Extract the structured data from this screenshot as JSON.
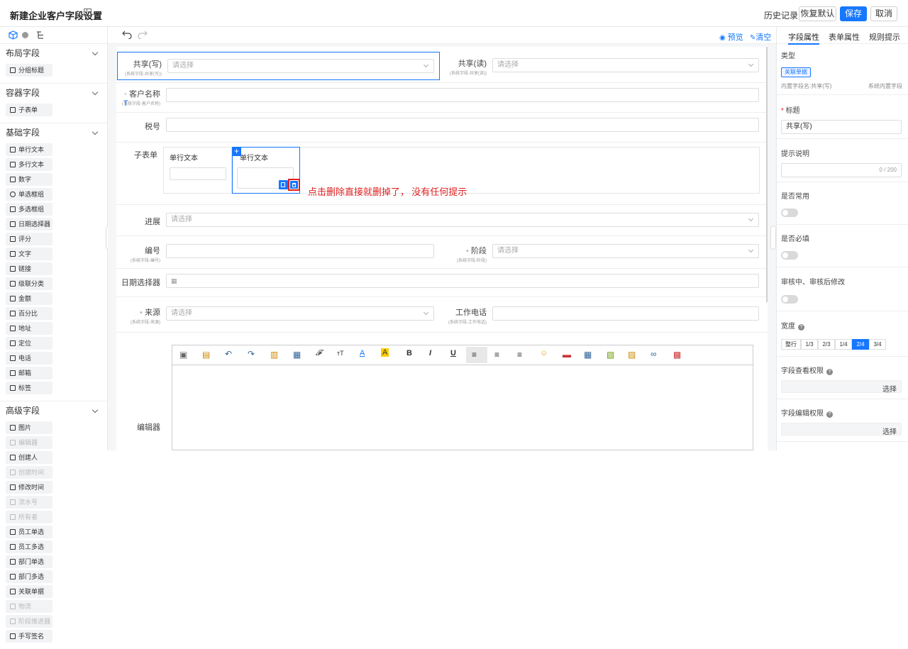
{
  "header": {
    "title": "新建企业客户字段设置",
    "history": "历史记录",
    "restore": "恢复默认",
    "save": "保存",
    "cancel": "取消"
  },
  "left": {
    "sections": [
      {
        "title": "布局字段",
        "items": [
          {
            "label": "分组标题"
          }
        ]
      },
      {
        "title": "容器字段",
        "items": [
          {
            "label": "子表单"
          }
        ]
      },
      {
        "title": "基础字段",
        "items": [
          {
            "label": "单行文本"
          },
          {
            "label": "多行文本"
          },
          {
            "label": "数字"
          },
          {
            "label": "单选框组"
          },
          {
            "label": "多选框组"
          },
          {
            "label": "日期选择器"
          },
          {
            "label": "评分"
          },
          {
            "label": "文字"
          },
          {
            "label": "链接"
          },
          {
            "label": "级联分类"
          },
          {
            "label": "金额"
          },
          {
            "label": "百分比"
          },
          {
            "label": "地址"
          },
          {
            "label": "定位"
          },
          {
            "label": "电话"
          },
          {
            "label": "邮箱"
          },
          {
            "label": "标签"
          }
        ]
      },
      {
        "title": "高级字段",
        "items": [
          {
            "label": "图片"
          },
          {
            "label": "编辑器"
          },
          {
            "label": "创建人"
          },
          {
            "label": "创建时间"
          },
          {
            "label": "修改时间"
          },
          {
            "label": "流水号"
          },
          {
            "label": "所有者"
          },
          {
            "label": "员工单选"
          },
          {
            "label": "员工多选"
          },
          {
            "label": "部门单选"
          },
          {
            "label": "部门多选"
          },
          {
            "label": "关联单据"
          },
          {
            "label": "物流"
          },
          {
            "label": "阶段推进器"
          },
          {
            "label": "手写签名"
          }
        ]
      }
    ]
  },
  "center": {
    "preview": "预览",
    "clear": "清空",
    "placeholder": "请选择",
    "fields": {
      "share_write": {
        "label": "共享(写)",
        "sub": "(系统字段-共享(写))"
      },
      "share_read": {
        "label": "共享(读)",
        "sub": "(系统字段-共享(读))"
      },
      "customer": {
        "label": "客户名称",
        "sub": "(系统字段-客户名称)"
      },
      "tax": {
        "label": "税号"
      },
      "subform": {
        "label": "子表单",
        "col1": "单行文本",
        "col2": "单行文本"
      },
      "progress": {
        "label": "进展"
      },
      "number": {
        "label": "编号",
        "sub": "(系统字段-编号)"
      },
      "stage": {
        "label": "阶段",
        "sub": "(系统字段-阶段)"
      },
      "date": {
        "label": "日期选择器"
      },
      "source": {
        "label": "来源",
        "sub": "(系统字段-来源)"
      },
      "phone": {
        "label": "工作电话",
        "sub": "(系统字段-工作电话)"
      },
      "editor": {
        "label": "编辑器"
      }
    },
    "note": "点击删除直接就删掉了， 没有任何提示"
  },
  "right": {
    "tabs": [
      "字段属性",
      "表单属性",
      "规则提示"
    ],
    "type_label": "类型",
    "type_tag": "关联单据",
    "builtin": "内置字段名:共享(写)",
    "system": "系统内置字段",
    "title_label": "标题",
    "title_value": "共享(写)",
    "desc_label": "提示说明",
    "desc_count": "0 / 200",
    "common_label": "是否常用",
    "required_label": "是否必填",
    "audit_label": "审核中、审核后修改",
    "width_label": "宽度",
    "widths": [
      "整行",
      "1/3",
      "2/3",
      "1/4",
      "2/4",
      "3/4"
    ],
    "width_selected": "2/4",
    "view_perm": "字段查看权限",
    "edit_perm": "字段编辑权限",
    "select": "选择"
  },
  "colors": {
    "primary": "#1677ff",
    "annotation": "#e02020"
  }
}
